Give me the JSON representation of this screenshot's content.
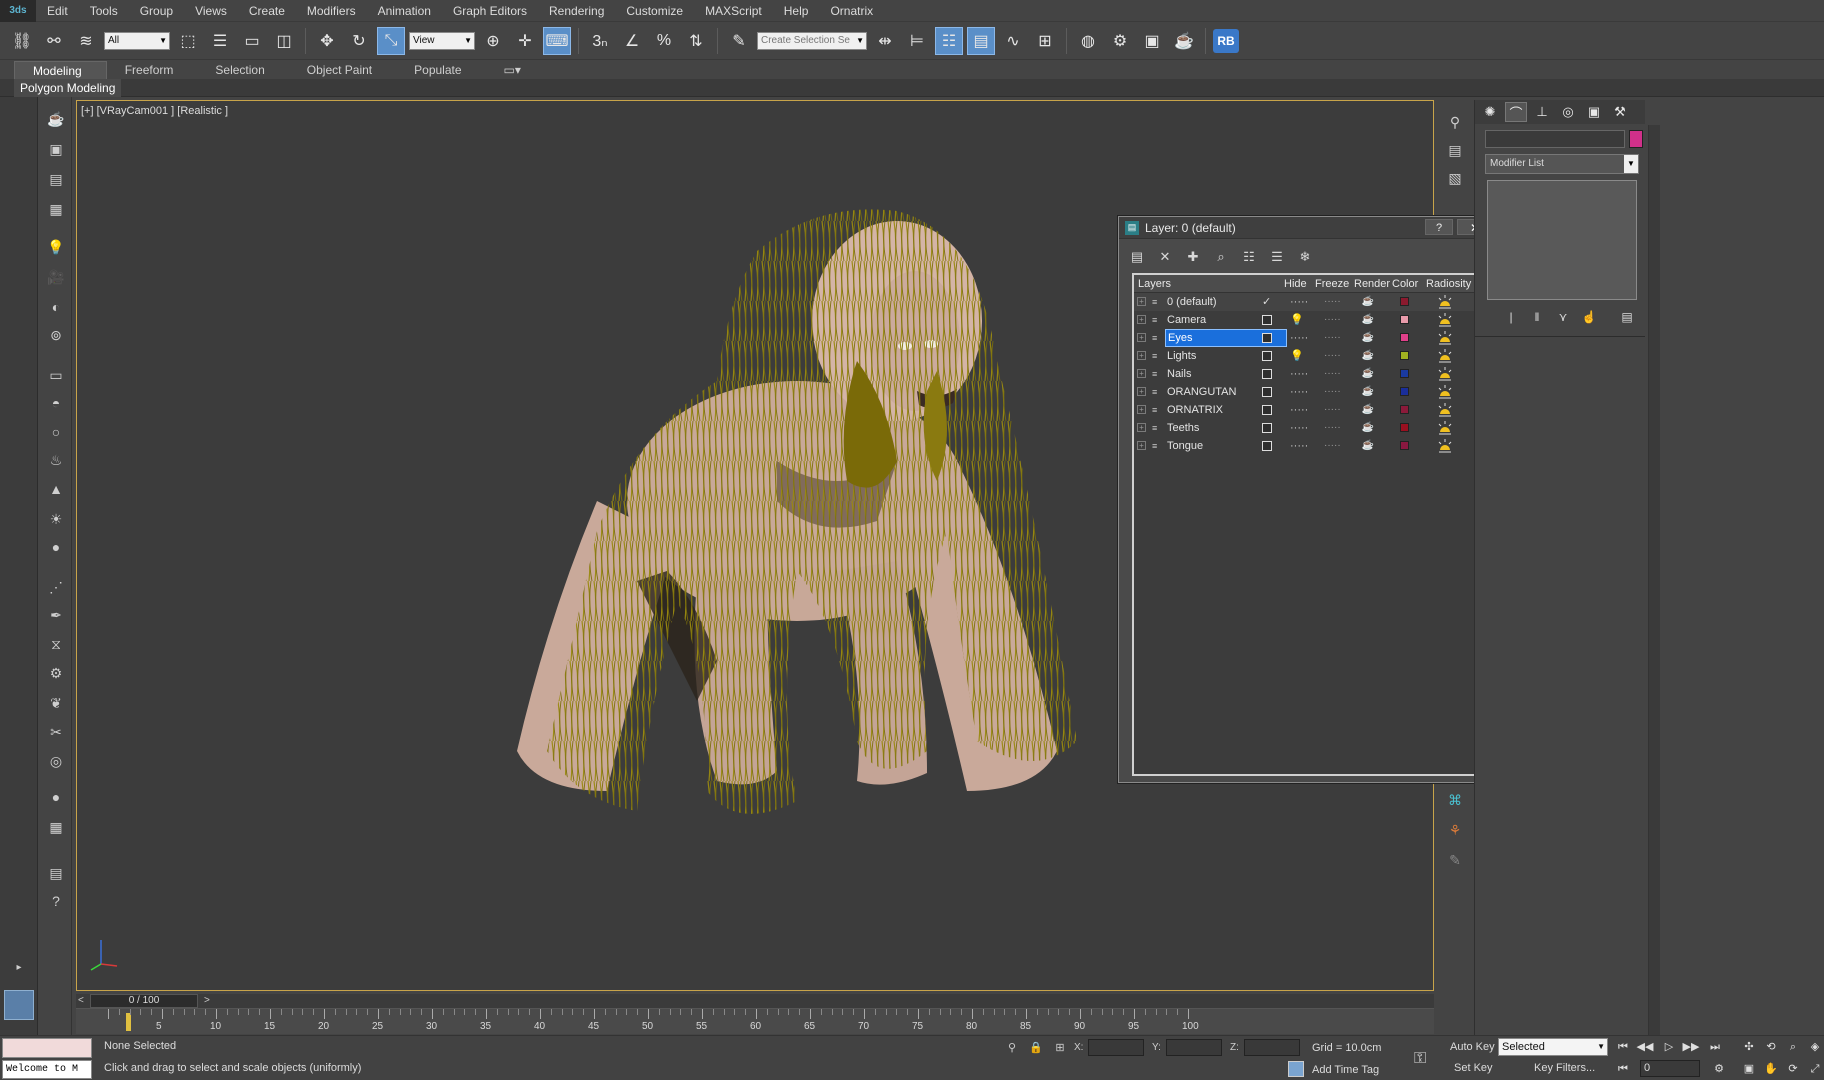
{
  "menu": {
    "items": [
      "Edit",
      "Tools",
      "Group",
      "Views",
      "Create",
      "Modifiers",
      "Animation",
      "Graph Editors",
      "Rendering",
      "Customize",
      "MAXScript",
      "Help",
      "Ornatrix"
    ]
  },
  "toolbar": {
    "filter_dropdown": "All",
    "ref_coord_dropdown": "View",
    "selection_set_placeholder": "Create Selection Se",
    "rb_label": "RB"
  },
  "ribbon": {
    "tabs": [
      "Modeling",
      "Freeform",
      "Selection",
      "Object Paint",
      "Populate"
    ],
    "active_tab": "Modeling",
    "sub_label": "Polygon Modeling"
  },
  "viewport": {
    "label": "[+] [VRayCam001 ] [Realistic ]",
    "subject": "orangutan-with-hair"
  },
  "command_panel": {
    "modifier_list": "Modifier List",
    "object_color": "#d1308a"
  },
  "layer_dialog": {
    "title": "Layer: 0 (default)",
    "help": "?",
    "close": "✕",
    "columns": [
      "Layers",
      "Hide",
      "Freeze",
      "Render",
      "Color",
      "Radiosity"
    ],
    "rows": [
      {
        "name": "0 (default)",
        "current": true,
        "hide_icon": "·····",
        "color": "#8b1a2e",
        "selected": false
      },
      {
        "name": "Camera",
        "current": false,
        "hide_icon": "bulb",
        "color": "#e89aaa",
        "selected": false
      },
      {
        "name": "Eyes",
        "current": false,
        "hide_icon": "·····",
        "color": "#e0408a",
        "selected": true
      },
      {
        "name": "Lights",
        "current": false,
        "hide_icon": "bulb",
        "color": "#a0b020",
        "selected": false
      },
      {
        "name": "Nails",
        "current": false,
        "hide_icon": "·····",
        "color": "#1a3aa0",
        "selected": false
      },
      {
        "name": "ORANGUTAN",
        "current": false,
        "hide_icon": "·····",
        "color": "#1a2e9a",
        "selected": false
      },
      {
        "name": "ORNATRIX",
        "current": false,
        "hide_icon": "·····",
        "color": "#8b1a3a",
        "selected": false
      },
      {
        "name": "Teeths",
        "current": false,
        "hide_icon": "·····",
        "color": "#9a1020",
        "selected": false
      },
      {
        "name": "Tongue",
        "current": false,
        "hide_icon": "·····",
        "color": "#8a1840",
        "selected": false
      }
    ]
  },
  "timeline": {
    "slider_label": "0 / 100",
    "ticks": [
      "5",
      "10",
      "15",
      "20",
      "25",
      "30",
      "35",
      "40",
      "45",
      "50",
      "55",
      "60",
      "65",
      "70",
      "75",
      "80",
      "85",
      "90",
      "95",
      "100"
    ]
  },
  "status": {
    "maxscript_text": "Welcome to M",
    "selection": "None Selected",
    "prompt": "Click and drag to select and scale objects (uniformly)",
    "x_label": "X:",
    "y_label": "Y:",
    "z_label": "Z:",
    "grid": "Grid = 10.0cm",
    "time_tag": "Add Time Tag",
    "auto_key": "Auto Key",
    "set_key": "Set Key",
    "key_mode": "Selected",
    "key_filters": "Key Filters...",
    "frame": "0"
  }
}
